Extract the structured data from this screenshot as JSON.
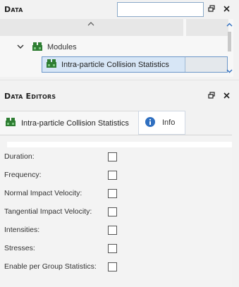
{
  "data_panel": {
    "title": "Data",
    "search_value": "",
    "tree": {
      "modules_label": "Modules",
      "selected_item_label": "Intra-particle Collision Statistics"
    }
  },
  "editors_panel": {
    "title": "Data Editors",
    "tabs": [
      {
        "label": "Intra-particle Collision Statistics",
        "icon": "module-icon",
        "active": true
      },
      {
        "label": "Info",
        "icon": "info-icon",
        "active": false
      }
    ],
    "properties": [
      {
        "label": "Duration:",
        "checked": false
      },
      {
        "label": "Frequency:",
        "checked": false
      },
      {
        "label": "Normal Impact Velocity:",
        "checked": false
      },
      {
        "label": "Tangential Impact Velocity:",
        "checked": false
      },
      {
        "label": "Intensities:",
        "checked": false
      },
      {
        "label": "Stresses:",
        "checked": false
      },
      {
        "label": "Enable per Group Statistics:",
        "checked": false
      }
    ]
  },
  "colors": {
    "module_icon": "#2e7d32",
    "info_icon": "#2f6fc0",
    "selection_bg": "#d7e6f6",
    "selection_border": "#6c97c9"
  }
}
